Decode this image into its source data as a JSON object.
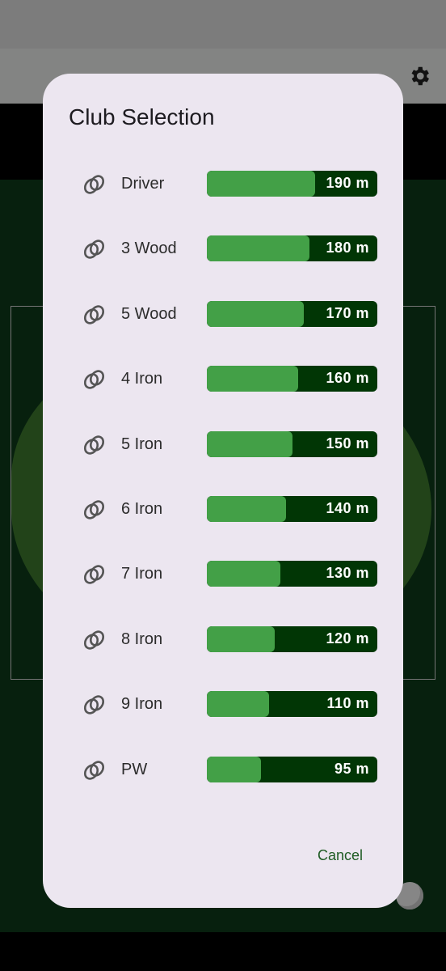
{
  "dialog": {
    "title": "Club Selection",
    "cancel_label": "Cancel"
  },
  "clubs": [
    {
      "name": "Driver",
      "distance_label": "190 m",
      "distance": 190
    },
    {
      "name": "3 Wood",
      "distance_label": "180 m",
      "distance": 180
    },
    {
      "name": "5 Wood",
      "distance_label": "170 m",
      "distance": 170
    },
    {
      "name": "4 Iron",
      "distance_label": "160 m",
      "distance": 160
    },
    {
      "name": "5 Iron",
      "distance_label": "150 m",
      "distance": 150
    },
    {
      "name": "6 Iron",
      "distance_label": "140 m",
      "distance": 140
    },
    {
      "name": "7 Iron",
      "distance_label": "130 m",
      "distance": 130
    },
    {
      "name": "8 Iron",
      "distance_label": "120 m",
      "distance": 120
    },
    {
      "name": "9 Iron",
      "distance_label": "110 m",
      "distance": 110
    },
    {
      "name": "PW",
      "distance_label": "95 m",
      "distance": 95
    }
  ],
  "bar_max_distance": 300,
  "colors": {
    "dialog_bg": "#ece6f0",
    "bar_track": "#013605",
    "bar_fill": "#43a047",
    "cancel_text": "#1e5b23"
  },
  "icons": {
    "club": "golf-club-icon",
    "back": "arrow-back-icon",
    "settings": "gear-icon"
  }
}
